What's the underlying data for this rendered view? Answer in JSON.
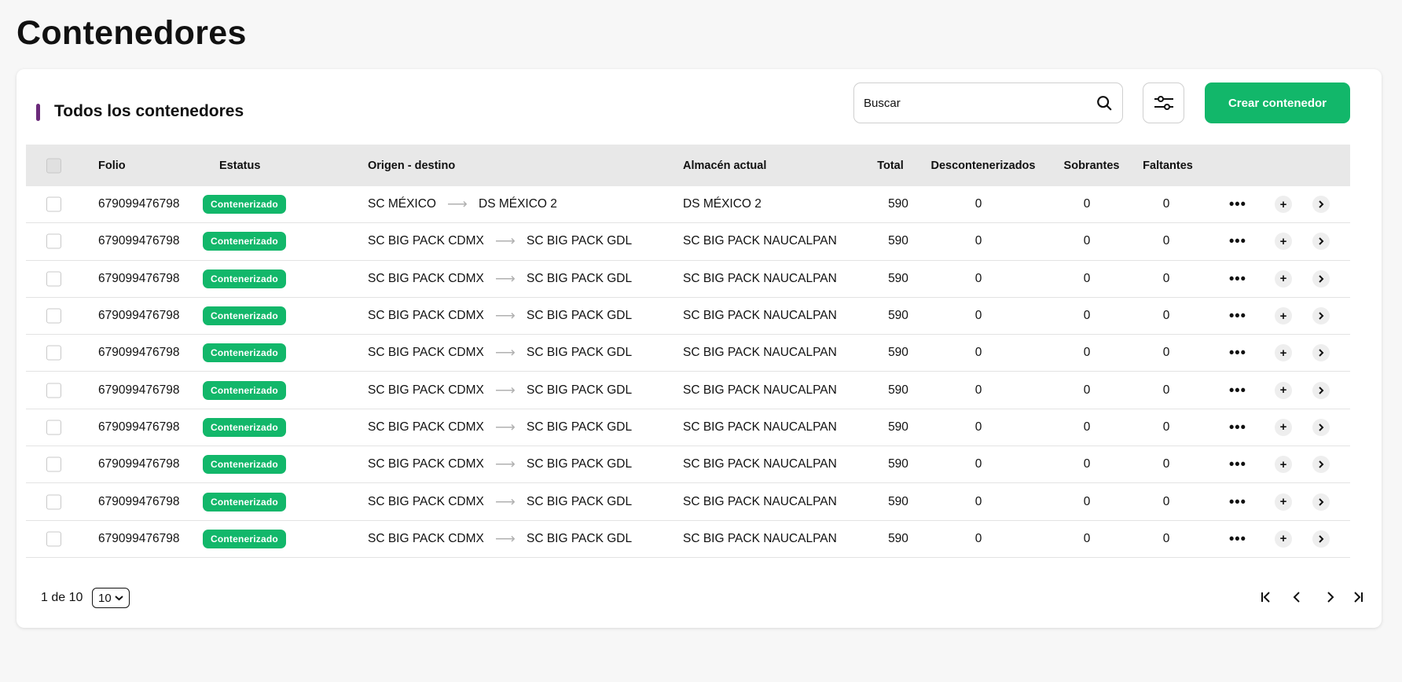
{
  "page": {
    "title": "Contenedores"
  },
  "section": {
    "title": "Todos los contenedores"
  },
  "search": {
    "placeholder": "Buscar"
  },
  "actions": {
    "create_label": "Crear contenedor"
  },
  "columns": {
    "folio": "Folio",
    "estatus": "Estatus",
    "origen": "Origen - destino",
    "almacen": "Almacén actual",
    "total": "Total",
    "descont": "Descontenerizados",
    "sobrantes": "Sobrantes",
    "faltantes": "Faltantes"
  },
  "rows": [
    {
      "folio": "679099476798",
      "status": "Contenerizado",
      "origen": "SC MÉXICO",
      "destino": "DS MÉXICO 2",
      "almacen": "DS MÉXICO 2",
      "total": "590",
      "descont": "0",
      "sobrantes": "0",
      "faltantes": "0"
    },
    {
      "folio": "679099476798",
      "status": "Contenerizado",
      "origen": "SC BIG PACK CDMX",
      "destino": "SC BIG PACK GDL",
      "almacen": "SC BIG PACK NAUCALPAN",
      "total": "590",
      "descont": "0",
      "sobrantes": "0",
      "faltantes": "0"
    },
    {
      "folio": "679099476798",
      "status": "Contenerizado",
      "origen": "SC BIG PACK CDMX",
      "destino": "SC BIG PACK GDL",
      "almacen": "SC BIG PACK NAUCALPAN",
      "total": "590",
      "descont": "0",
      "sobrantes": "0",
      "faltantes": "0"
    },
    {
      "folio": "679099476798",
      "status": "Contenerizado",
      "origen": "SC BIG PACK CDMX",
      "destino": "SC BIG PACK GDL",
      "almacen": "SC BIG PACK NAUCALPAN",
      "total": "590",
      "descont": "0",
      "sobrantes": "0",
      "faltantes": "0"
    },
    {
      "folio": "679099476798",
      "status": "Contenerizado",
      "origen": "SC BIG PACK CDMX",
      "destino": "SC BIG PACK GDL",
      "almacen": "SC BIG PACK NAUCALPAN",
      "total": "590",
      "descont": "0",
      "sobrantes": "0",
      "faltantes": "0"
    },
    {
      "folio": "679099476798",
      "status": "Contenerizado",
      "origen": "SC BIG PACK CDMX",
      "destino": "SC BIG PACK GDL",
      "almacen": "SC BIG PACK NAUCALPAN",
      "total": "590",
      "descont": "0",
      "sobrantes": "0",
      "faltantes": "0"
    },
    {
      "folio": "679099476798",
      "status": "Contenerizado",
      "origen": "SC BIG PACK CDMX",
      "destino": "SC BIG PACK GDL",
      "almacen": "SC BIG PACK NAUCALPAN",
      "total": "590",
      "descont": "0",
      "sobrantes": "0",
      "faltantes": "0"
    },
    {
      "folio": "679099476798",
      "status": "Contenerizado",
      "origen": "SC BIG PACK CDMX",
      "destino": "SC BIG PACK GDL",
      "almacen": "SC BIG PACK NAUCALPAN",
      "total": "590",
      "descont": "0",
      "sobrantes": "0",
      "faltantes": "0"
    },
    {
      "folio": "679099476798",
      "status": "Contenerizado",
      "origen": "SC BIG PACK CDMX",
      "destino": "SC BIG PACK GDL",
      "almacen": "SC BIG PACK NAUCALPAN",
      "total": "590",
      "descont": "0",
      "sobrantes": "0",
      "faltantes": "0"
    },
    {
      "folio": "679099476798",
      "status": "Contenerizado",
      "origen": "SC BIG PACK CDMX",
      "destino": "SC BIG PACK GDL",
      "almacen": "SC BIG PACK NAUCALPAN",
      "total": "590",
      "descont": "0",
      "sobrantes": "0",
      "faltantes": "0"
    }
  ],
  "pagination": {
    "summary": "1 de 10",
    "page_size": "10"
  },
  "icons": {
    "search": "search-icon",
    "filter": "sliders-icon",
    "more": "more-horizontal-icon",
    "plus": "plus-icon",
    "chevron": "chevron-right-icon",
    "first": "first-page-icon",
    "prev": "chevron-left-icon",
    "next": "chevron-right-icon",
    "last": "last-page-icon",
    "arrow": "arrow-right-icon",
    "dropdown": "chevron-down-icon"
  },
  "colors": {
    "accent": "#12b76a",
    "section_marker": "#6b2a7a",
    "header_bg": "#e8e8e8"
  }
}
